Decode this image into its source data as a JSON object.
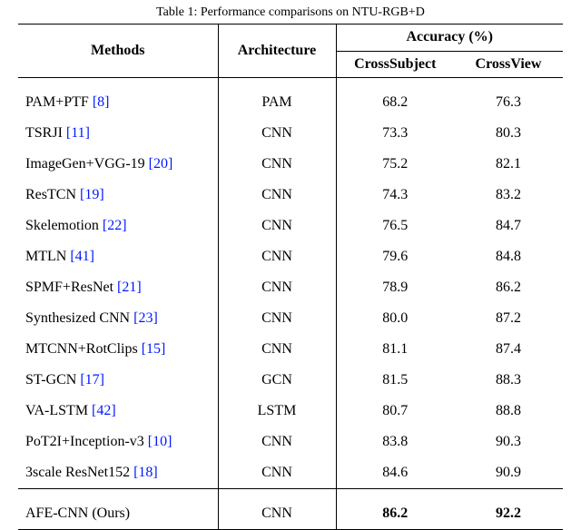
{
  "caption": "Table 1: Performance comparisons on NTU-RGB+D",
  "headers": {
    "methods": "Methods",
    "architecture": "Architecture",
    "accuracy": "Accuracy (%)",
    "cross_subject": "CrossSubject",
    "cross_view": "CrossView"
  },
  "rows": [
    {
      "method": "PAM+PTF",
      "cite": "[8]",
      "arch": "PAM",
      "cs": "68.2",
      "cv": "76.3"
    },
    {
      "method": "TSRJI",
      "cite": "[11]",
      "arch": "CNN",
      "cs": "73.3",
      "cv": "80.3"
    },
    {
      "method": "ImageGen+VGG-19",
      "cite": "[20]",
      "arch": "CNN",
      "cs": "75.2",
      "cv": "82.1"
    },
    {
      "method": "ResTCN",
      "cite": "[19]",
      "arch": "CNN",
      "cs": "74.3",
      "cv": "83.2"
    },
    {
      "method": "Skelemotion",
      "cite": "[22]",
      "arch": "CNN",
      "cs": "76.5",
      "cv": "84.7"
    },
    {
      "method": "MTLN",
      "cite": "[41]",
      "arch": "CNN",
      "cs": "79.6",
      "cv": "84.8"
    },
    {
      "method": "SPMF+ResNet",
      "cite": "[21]",
      "arch": "CNN",
      "cs": "78.9",
      "cv": "86.2"
    },
    {
      "method": "Synthesized CNN",
      "cite": "[23]",
      "arch": "CNN",
      "cs": "80.0",
      "cv": "87.2"
    },
    {
      "method": "MTCNN+RotClips",
      "cite": "[15]",
      "arch": "CNN",
      "cs": "81.1",
      "cv": "87.4"
    },
    {
      "method": "ST-GCN",
      "cite": "[17]",
      "arch": "GCN",
      "cs": "81.5",
      "cv": "88.3"
    },
    {
      "method": "VA-LSTM",
      "cite": "[42]",
      "arch": "LSTM",
      "cs": "80.7",
      "cv": "88.8"
    },
    {
      "method": "PoT2I+Inception-v3",
      "cite": "[10]",
      "arch": "CNN",
      "cs": "83.8",
      "cv": "90.3"
    },
    {
      "method": "3scale ResNet152",
      "cite": "[18]",
      "arch": "CNN",
      "cs": "84.6",
      "cv": "90.9"
    }
  ],
  "ours": {
    "method": "AFE-CNN (Ours)",
    "cite": "",
    "arch": "CNN",
    "cs": "86.2",
    "cv": "92.2"
  },
  "chart_data": {
    "type": "table",
    "title": "Performance comparisons on NTU-RGB+D",
    "columns": [
      "Methods",
      "Architecture",
      "CrossSubject",
      "CrossView"
    ],
    "units": {
      "CrossSubject": "%",
      "CrossView": "%"
    },
    "data": [
      [
        "PAM+PTF [8]",
        "PAM",
        68.2,
        76.3
      ],
      [
        "TSRJI [11]",
        "CNN",
        73.3,
        80.3
      ],
      [
        "ImageGen+VGG-19 [20]",
        "CNN",
        75.2,
        82.1
      ],
      [
        "ResTCN [19]",
        "CNN",
        74.3,
        83.2
      ],
      [
        "Skelemotion [22]",
        "CNN",
        76.5,
        84.7
      ],
      [
        "MTLN [41]",
        "CNN",
        79.6,
        84.8
      ],
      [
        "SPMF+ResNet [21]",
        "CNN",
        78.9,
        86.2
      ],
      [
        "Synthesized CNN [23]",
        "CNN",
        80.0,
        87.2
      ],
      [
        "MTCNN+RotClips [15]",
        "CNN",
        81.1,
        87.4
      ],
      [
        "ST-GCN [17]",
        "GCN",
        81.5,
        88.3
      ],
      [
        "VA-LSTM [42]",
        "LSTM",
        80.7,
        88.8
      ],
      [
        "PoT2I+Inception-v3 [10]",
        "CNN",
        83.8,
        90.3
      ],
      [
        "3scale ResNet152 [18]",
        "CNN",
        84.6,
        90.9
      ],
      [
        "AFE-CNN (Ours)",
        "CNN",
        86.2,
        92.2
      ]
    ]
  }
}
